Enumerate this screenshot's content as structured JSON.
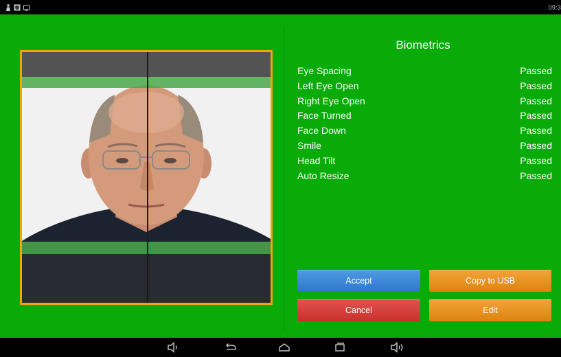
{
  "status_bar": {
    "clock": "09:3",
    "left_icons": [
      "person-icon",
      "shield-icon",
      "screen-icon"
    ]
  },
  "panel": {
    "title": "Biometrics",
    "metrics": [
      {
        "label": "Eye Spacing",
        "status": "Passed"
      },
      {
        "label": "Left Eye Open",
        "status": "Passed"
      },
      {
        "label": "Right Eye Open",
        "status": "Passed"
      },
      {
        "label": "Face Turned",
        "status": "Passed"
      },
      {
        "label": "Face Down",
        "status": "Passed"
      },
      {
        "label": "Smile",
        "status": "Passed"
      },
      {
        "label": "Head Tilt",
        "status": "Passed"
      },
      {
        "label": "Auto Resize",
        "status": "Passed"
      }
    ]
  },
  "buttons": {
    "accept": "Accept",
    "copy_usb": "Copy to USB",
    "cancel": "Cancel",
    "edit": "Edit"
  },
  "nav_bar": {
    "icons": [
      "volume-down-icon",
      "back-icon",
      "home-icon",
      "recent-apps-icon",
      "volume-up-icon"
    ]
  },
  "colors": {
    "background": "#08ab08",
    "frame_border": "#f2a600",
    "accept": "#3a86d6",
    "cancel": "#d43f3c",
    "orange": "#e8920f"
  }
}
